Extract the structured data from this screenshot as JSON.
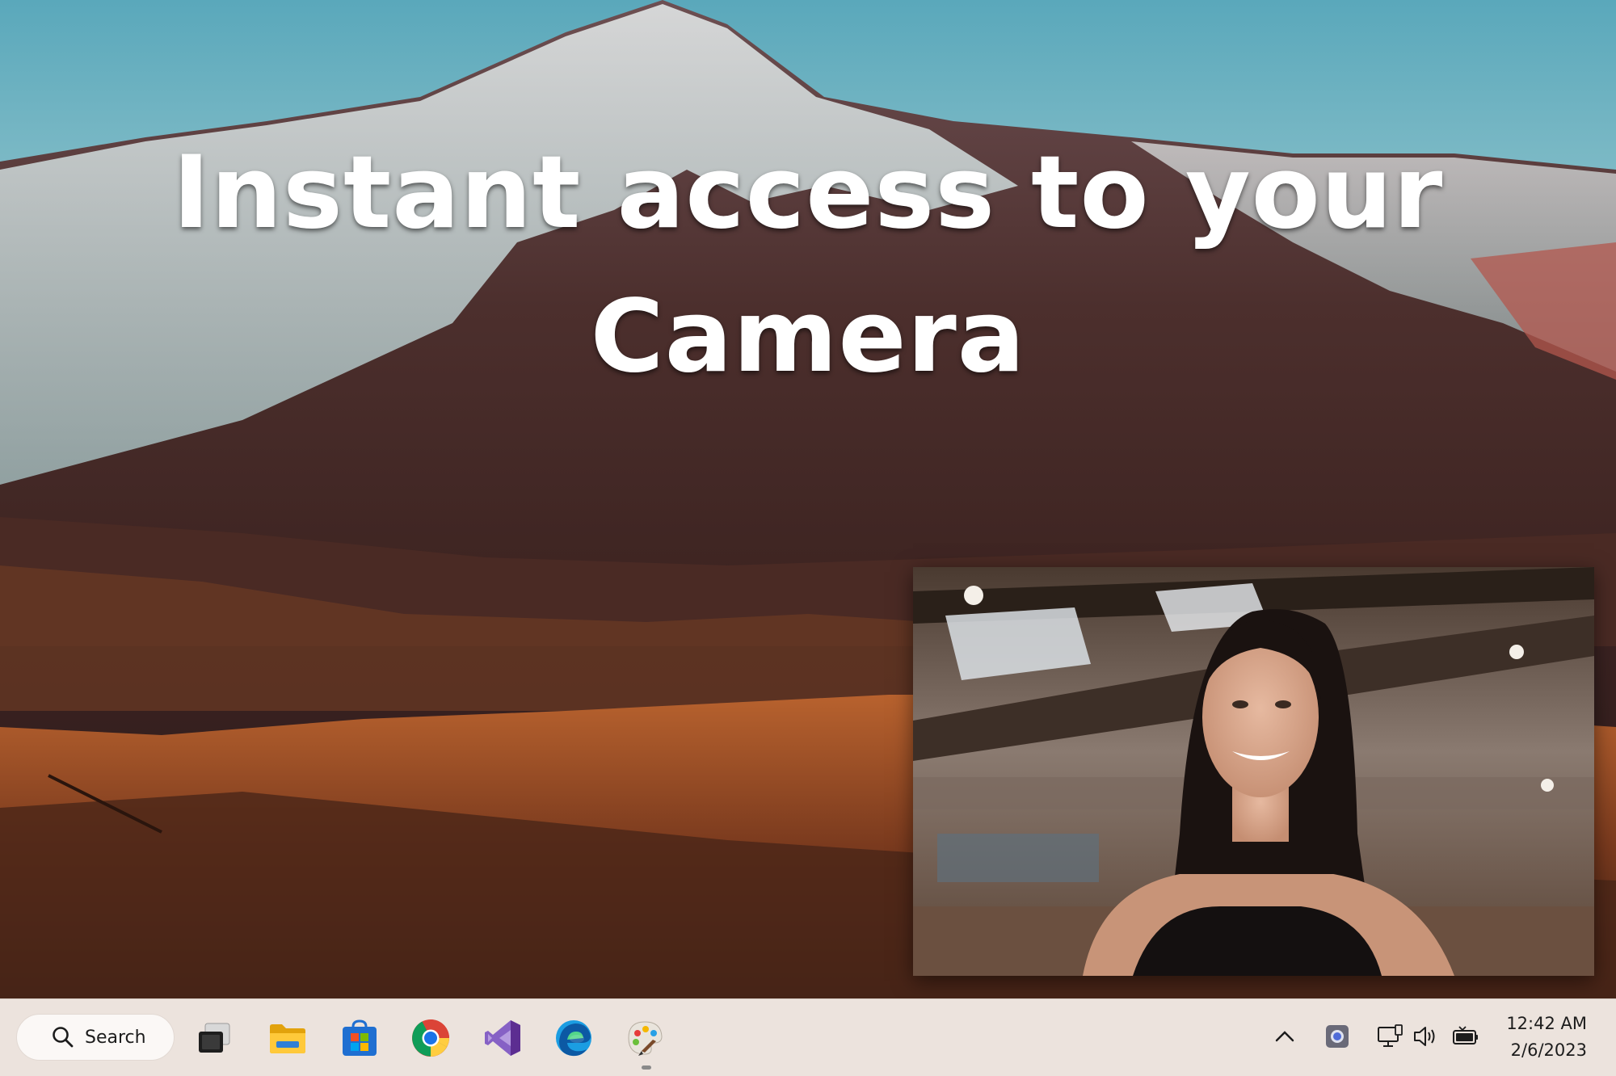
{
  "headline": {
    "line1": "Instant access to your",
    "line2": "Camera"
  },
  "camera": {
    "icon": "webcam-preview"
  },
  "taskbar": {
    "search_label": "Search",
    "apps": [
      {
        "name": "task-view-icon"
      },
      {
        "name": "file-explorer-icon"
      },
      {
        "name": "microsoft-store-icon"
      },
      {
        "name": "chrome-icon"
      },
      {
        "name": "visual-studio-icon"
      },
      {
        "name": "edge-icon"
      },
      {
        "name": "paint-icon"
      }
    ],
    "tray": {
      "icons": [
        "chevron-up-icon",
        "camera-app-icon",
        "network-icon",
        "volume-icon",
        "battery-icon"
      ]
    },
    "clock": {
      "time": "12:42 AM",
      "date": "2/6/2023"
    }
  },
  "colors": {
    "taskbar_bg": "#ece3dd",
    "headline_text": "#ffffff",
    "accent_visual_studio": "#8661c5",
    "accent_edge": "#1b9de2"
  }
}
